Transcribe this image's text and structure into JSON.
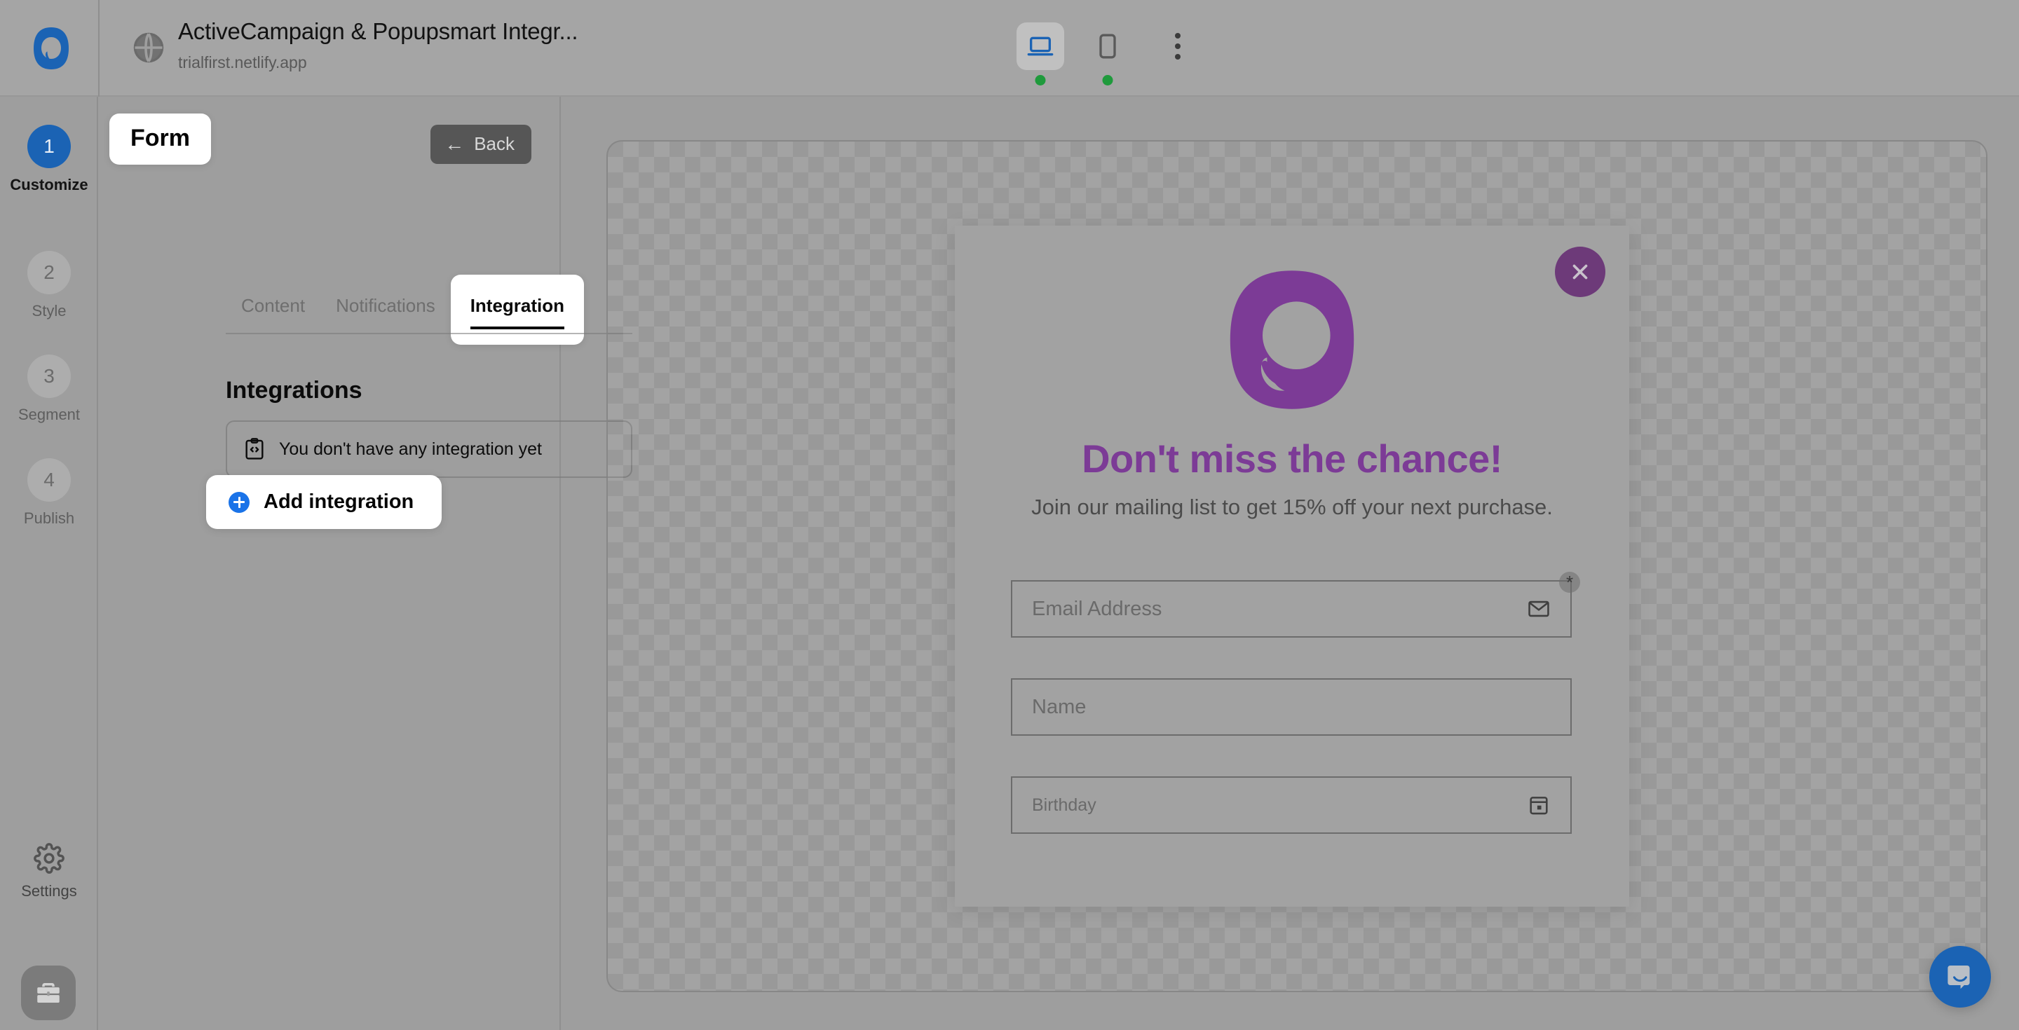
{
  "header": {
    "site_title": "ActiveCampaign & Popupsmart Integr...",
    "site_url": "trialfirst.netlify.app",
    "brand_icon": "popupsmart-logo-icon",
    "globe_icon": "globe-icon",
    "devices": [
      {
        "name": "desktop",
        "icon": "laptop-icon",
        "active": true,
        "status": "online"
      },
      {
        "name": "mobile",
        "icon": "phone-icon",
        "active": false,
        "status": "online"
      }
    ],
    "more_icon": "kebab-menu-icon",
    "status_color": "#1f9a3c"
  },
  "rail": {
    "steps": [
      {
        "number": "1",
        "label": "Customize",
        "active": true
      },
      {
        "number": "2",
        "label": "Style",
        "active": false
      },
      {
        "number": "3",
        "label": "Segment",
        "active": false
      },
      {
        "number": "4",
        "label": "Publish",
        "active": false
      }
    ],
    "settings_label": "Settings",
    "settings_icon": "gear-icon",
    "briefcase_icon": "briefcase-icon",
    "active_color": "#1b63b4"
  },
  "panel": {
    "badge": "Form",
    "back_label": "Back",
    "back_icon": "arrow-left-icon",
    "tabs": [
      {
        "label": "Content",
        "active": false
      },
      {
        "label": "Notifications",
        "active": false
      },
      {
        "label": "Integration",
        "active": true
      }
    ],
    "section_title": "Integrations",
    "empty_state": {
      "text": "You don't have any integration yet",
      "icon": "clipboard-code-icon"
    },
    "add_integration": {
      "label": "Add integration",
      "icon": "plus-circle-icon",
      "accent": "#1a73e8"
    }
  },
  "popup": {
    "close_icon": "close-icon",
    "close_bg": "#6d3a79",
    "logo_icon": "popupsmart-p-logo",
    "logo_color": "#7c3b96",
    "heading": "Don't miss the chance!",
    "heading_color": "#7c3b96",
    "subtext": "Join our mailing list to get 15% off your next purchase.",
    "fields": [
      {
        "placeholder": "Email Address",
        "icon": "envelope-icon",
        "required": true,
        "required_marker": "*"
      },
      {
        "placeholder": "Name",
        "icon": "",
        "required": false
      },
      {
        "placeholder": "Birthday",
        "icon": "calendar-icon",
        "required": false
      }
    ]
  },
  "chat": {
    "icon": "chat-bubble-icon",
    "color": "#1b63b4"
  }
}
